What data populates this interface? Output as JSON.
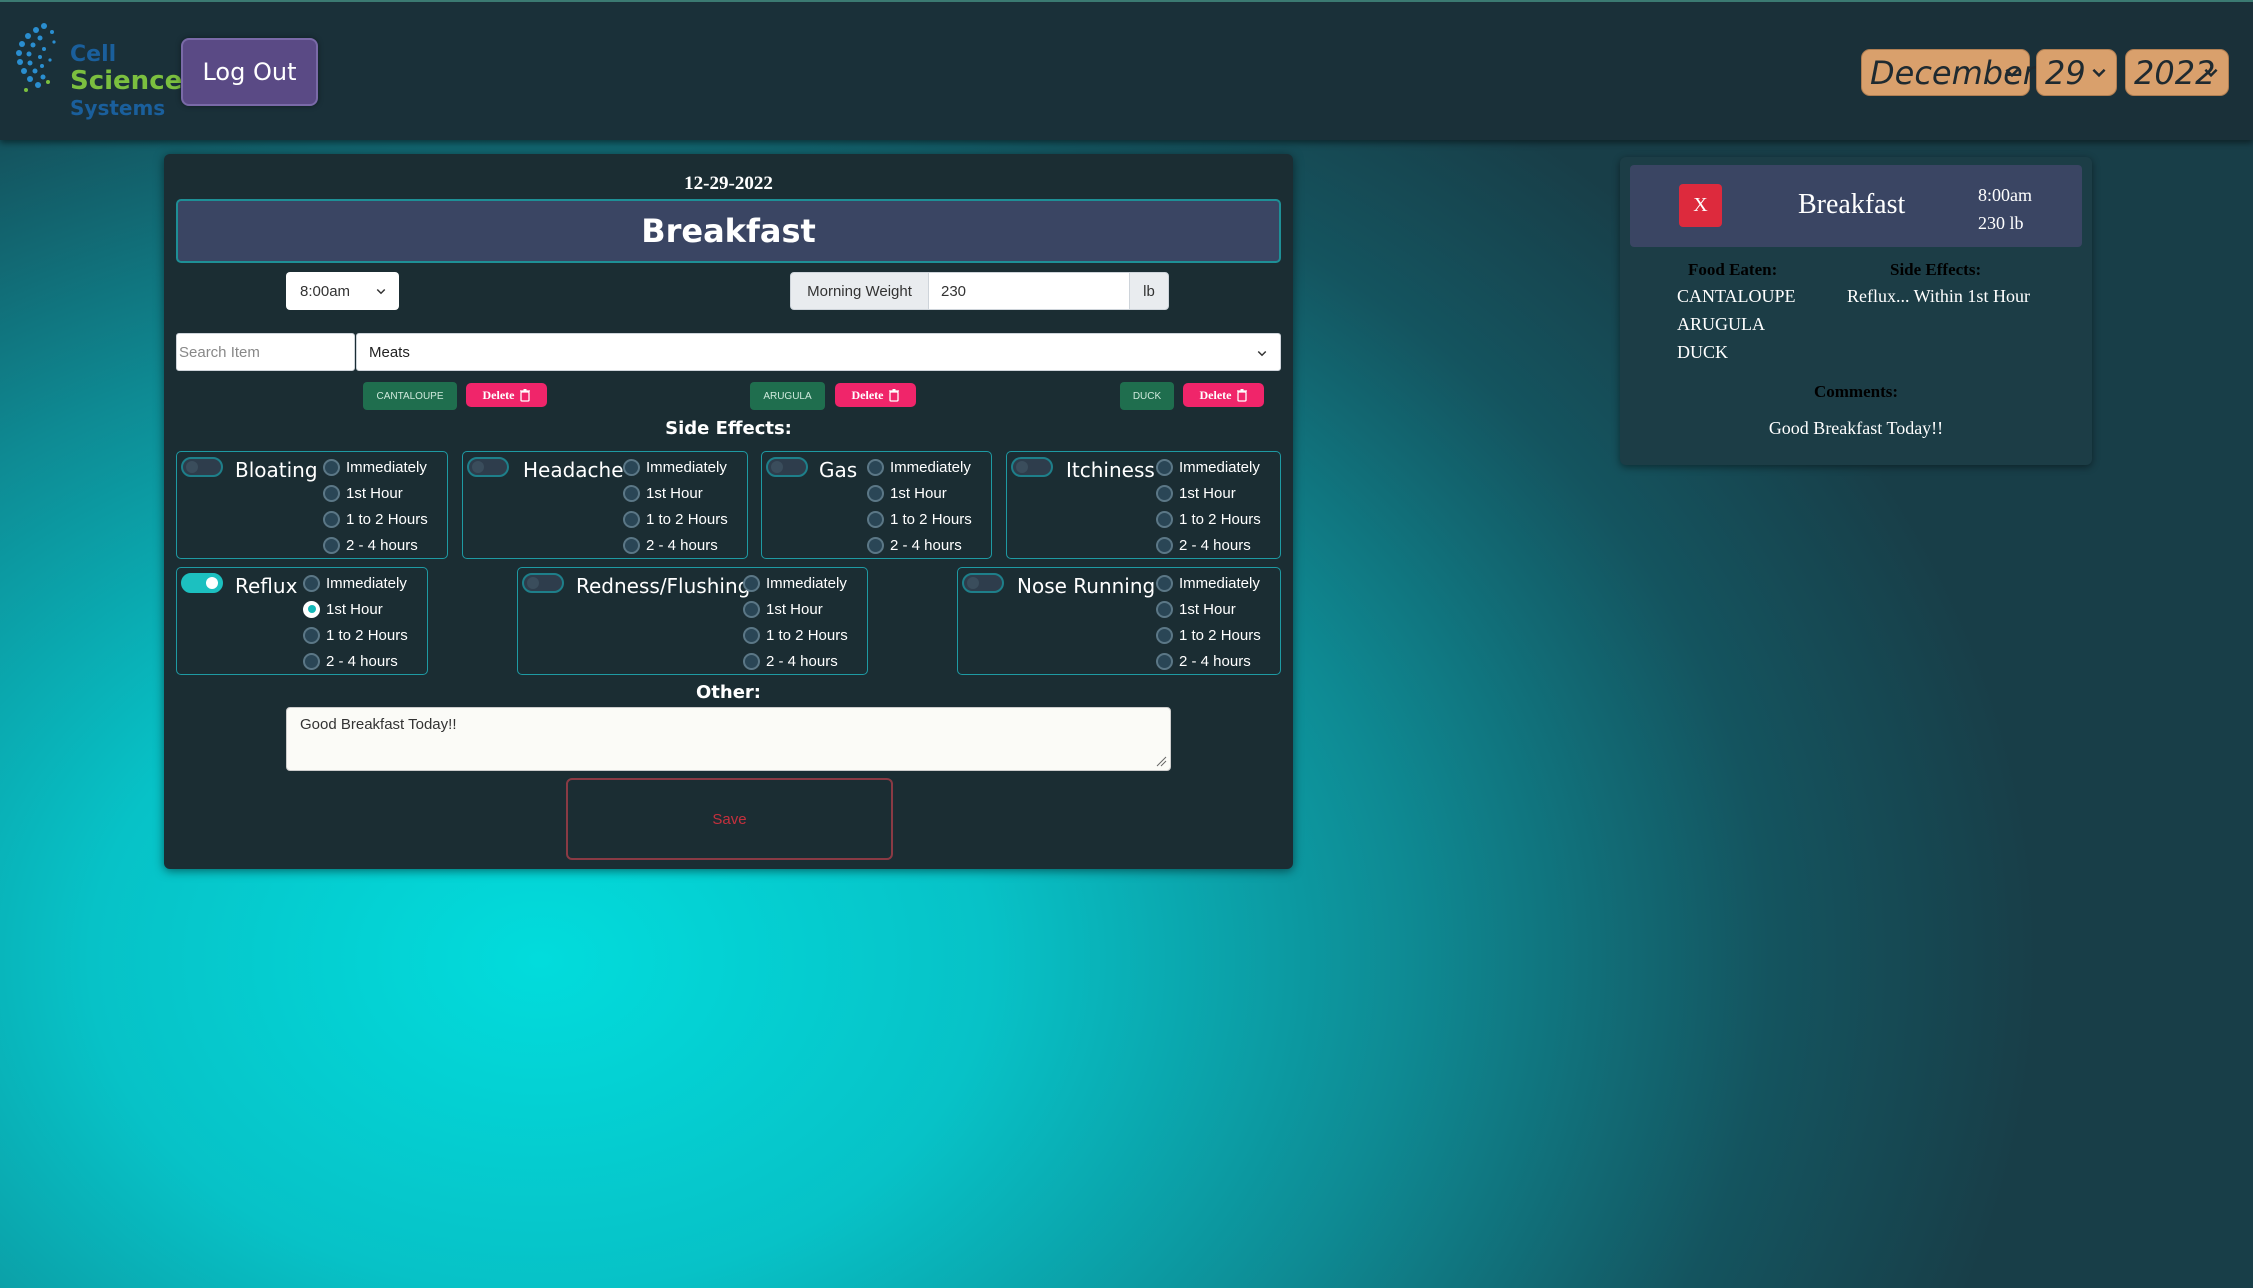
{
  "header": {
    "logo": {
      "line1": "Cell",
      "line2": "Science",
      "line3": "Systems"
    },
    "logout_label": "Log Out",
    "date": {
      "month": "December",
      "day": "29",
      "year": "2022"
    }
  },
  "entry": {
    "date": "12-29-2022",
    "meal": "Breakfast",
    "time": "8:00am",
    "weight": {
      "label": "Morning Weight",
      "value": "230",
      "unit": "lb"
    },
    "search_placeholder": "Search Item",
    "category": "Meats",
    "foods": [
      {
        "name": "CANTALOUPE",
        "delete_label": "Delete"
      },
      {
        "name": "ARUGULA",
        "delete_label": "Delete"
      },
      {
        "name": "DUCK",
        "delete_label": "Delete"
      }
    ],
    "side_effects_title": "Side Effects:",
    "timing_options": [
      "Immediately",
      "1st Hour",
      "1 to 2 Hours",
      "2 - 4 hours"
    ],
    "side_effects": [
      {
        "name": "Bloating",
        "on": false,
        "selected": null
      },
      {
        "name": "Headache",
        "on": false,
        "selected": null
      },
      {
        "name": "Gas",
        "on": false,
        "selected": null
      },
      {
        "name": "Itchiness",
        "on": false,
        "selected": null
      },
      {
        "name": "Reflux",
        "on": true,
        "selected": 1
      },
      {
        "name": "Redness/Flushing",
        "on": false,
        "selected": null
      },
      {
        "name": "Nose Running",
        "on": false,
        "selected": null
      }
    ],
    "other_title": "Other:",
    "other_text": "Good Breakfast Today!!",
    "save_label": "Save"
  },
  "summary": {
    "close_label": "X",
    "meal": "Breakfast",
    "time": "8:00am",
    "weight": "230 lb",
    "food_label": "Food Eaten:",
    "foods": [
      "CANTALOUPE",
      "ARUGULA",
      "DUCK"
    ],
    "side_label": "Side Effects:",
    "side_text": "Reflux... Within 1st Hour",
    "comments_label": "Comments:",
    "comments_text": "Good Breakfast Today!!"
  },
  "colors": {
    "accent_teal": "#1cc0c0",
    "delete_pink": "#f0256a",
    "food_chip_green": "#1f6e4e",
    "date_select_tan": "#d9a06c",
    "logout_purple": "#5a4a85",
    "close_red": "#dd2a3d"
  },
  "icons": {
    "chevron": "chevron-down-icon",
    "trash": "trash-icon",
    "resize": "resize-grip-icon"
  }
}
